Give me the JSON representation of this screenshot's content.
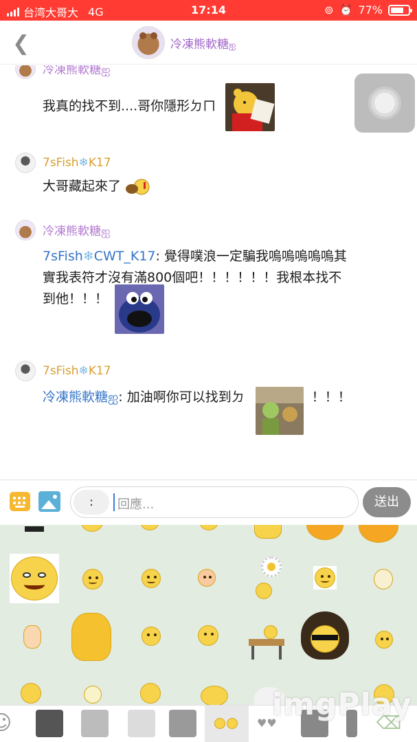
{
  "status_bar": {
    "carrier": "台湾大哥大",
    "network": "4G",
    "time": "17:14",
    "battery": "77%",
    "battery_level": 0.77
  },
  "header": {
    "title": "冷凍熊軟糖",
    "title_suffix": "ஐ"
  },
  "messages": [
    {
      "sender": "冷凍熊軟糖ஐ",
      "text": "我真的找不到....哥你隱形ㄉㄇ",
      "sticker": "pooh-reading"
    },
    {
      "sender_prefix": "7sFish",
      "sender_snow": "❄",
      "sender_suffix": "K17",
      "text": "大哥藏起來了",
      "sticker": "small-emoji"
    },
    {
      "sender": "冷凍熊軟糖ஐ",
      "mention_prefix": "7sFish",
      "mention_snow": "❄",
      "mention_suffix": "CWT_K17",
      "text_line1": ": 覺得噗浪一定騙我嗚嗚嗚嗚嗚其",
      "text_line2": "實我表符才沒有滿800個吧！！！！！！我根本找不",
      "text_line3": "到他！！！",
      "sticker": "cookie-monster"
    },
    {
      "sender_prefix": "7sFish",
      "sender_snow": "❄",
      "sender_suffix": "K17",
      "mention": "冷凍熊軟糖ஐ",
      "text": ": 加油啊你可以找到ㄉ",
      "text_after": "！！！",
      "sticker": "two-figures"
    }
  ],
  "input": {
    "colon_chip": ":",
    "placeholder": "回應...",
    "send_label": "送出"
  },
  "watermark": "imgPlay",
  "colors": {
    "status_bar": "#ff3b33",
    "name_pink": "#b27ad0",
    "name_gold": "#d6a030",
    "mention_blue": "#3574c8",
    "panel_bg": "#e3ece1",
    "send_button": "#8c8c8c"
  }
}
